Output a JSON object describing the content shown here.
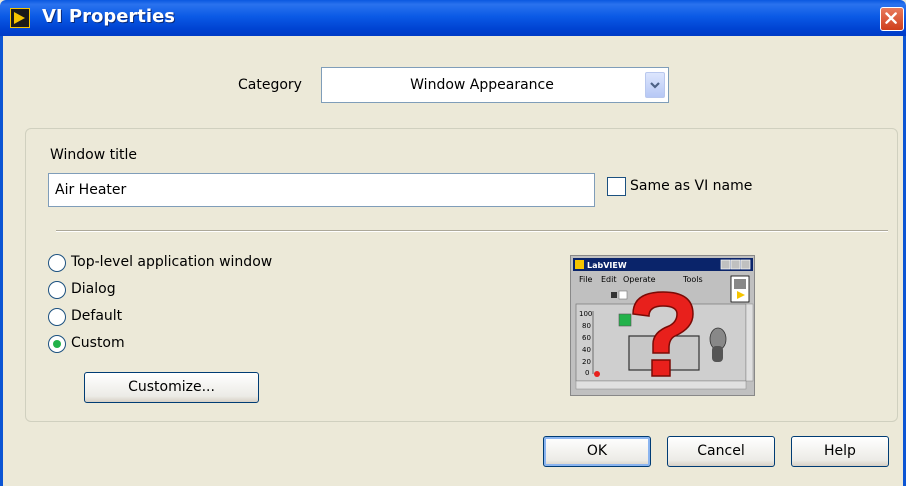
{
  "window": {
    "title": "VI Properties",
    "title_icon": "labview-vi-icon",
    "close_icon": "close-icon"
  },
  "category": {
    "label": "Category",
    "selected": "Window Appearance",
    "dropdown_icon": "chevron-down-icon"
  },
  "window_title_section": {
    "label": "Window title",
    "value": "Air Heater",
    "same_as_vi_name": {
      "label": "Same as VI name",
      "checked": false
    }
  },
  "appearance_options": [
    {
      "label": "Top-level application window",
      "selected": false
    },
    {
      "label": "Dialog",
      "selected": false
    },
    {
      "label": "Default",
      "selected": false
    },
    {
      "label": "Custom",
      "selected": true
    }
  ],
  "customize_button": "Customize...",
  "preview": {
    "title": "LabVIEW",
    "menu": [
      "File",
      "Edit",
      "Operate",
      "Tools"
    ],
    "scale": [
      "100",
      "80",
      "60",
      "40",
      "20",
      "0"
    ],
    "overlay_icon": "question-mark-icon"
  },
  "buttons": {
    "ok": "OK",
    "cancel": "Cancel",
    "help": "Help"
  },
  "colors": {
    "titlebar": "#0054e3",
    "dialog_bg": "#ece9d8",
    "radio_dot": "#22b24a",
    "question_mark": "#e8201c"
  }
}
